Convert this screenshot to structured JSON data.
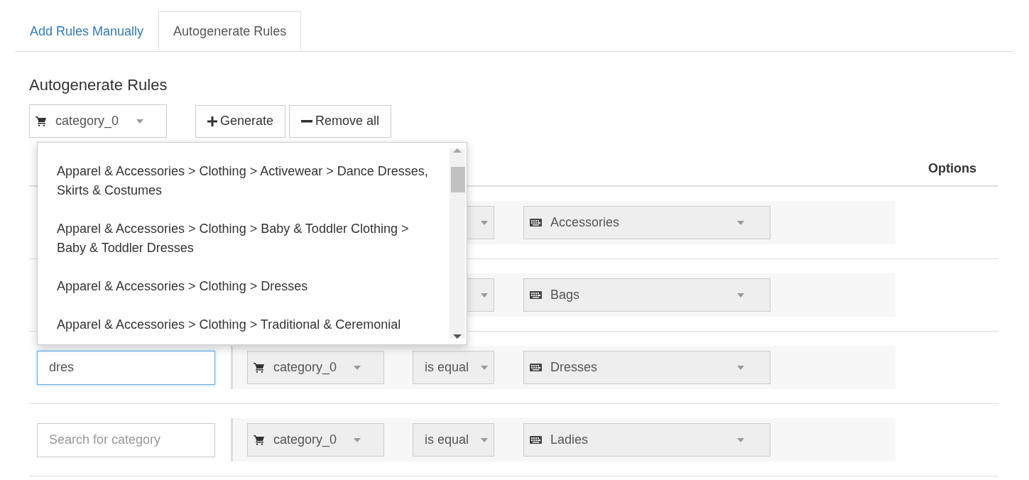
{
  "tabs": [
    {
      "label": "Add Rules Manually",
      "selected": false
    },
    {
      "label": "Autogenerate Rules",
      "selected": true
    }
  ],
  "heading": "Autogenerate Rules",
  "toolbar": {
    "attribute_select": "category_0",
    "buttons": [
      {
        "kind": "add",
        "label": "Generate"
      },
      {
        "kind": "remove",
        "label": "Remove all"
      }
    ]
  },
  "table": {
    "columns": [
      {
        "label": "Options"
      }
    ],
    "rows": [
      {
        "value": "Accessories"
      },
      {
        "value": "Bags"
      },
      {
        "search": {
          "value": "dres",
          "focused": true
        },
        "attribute": "category_0",
        "operator": "is equal",
        "value": "Dresses"
      },
      {
        "search": {
          "placeholder": "Search for category",
          "focused": false
        },
        "attribute": "category_0",
        "operator": "is equal",
        "value": "Ladies"
      }
    ]
  },
  "dropdown": {
    "items": [
      "Apparel & Accessories > Clothing > Activewear > Dance Dresses, Skirts & Costumes",
      "Apparel & Accessories > Clothing > Baby & Toddler Clothing > Baby & Toddler Dresses",
      "Apparel & Accessories > Clothing > Dresses",
      "Apparel & Accessories > Clothing > Traditional & Ceremonial"
    ]
  }
}
